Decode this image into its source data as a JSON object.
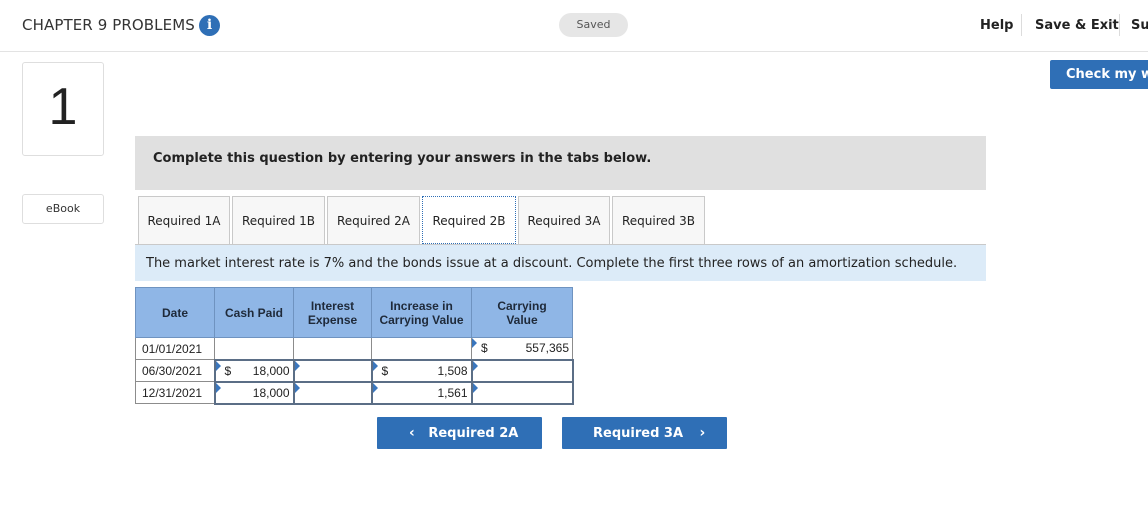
{
  "header": {
    "title": "CHAPTER 9 PROBLEMS",
    "info_icon": "info-icon",
    "saved": "Saved",
    "help": "Help",
    "save_exit": "Save & Exit",
    "submit_partial": "Su"
  },
  "sidebar": {
    "question_number": "1",
    "ebook": "eBook"
  },
  "check_button": "Check my wo",
  "instruction": "Complete this question by entering your answers in the tabs below.",
  "tabs": [
    {
      "label": "Required 1A",
      "active": false
    },
    {
      "label": "Required 1B",
      "active": false
    },
    {
      "label": "Required 2A",
      "active": false
    },
    {
      "label": "Required 2B",
      "active": true
    },
    {
      "label": "Required 3A",
      "active": false
    },
    {
      "label": "Required 3B",
      "active": false
    }
  ],
  "prompt": "The market interest rate is 7% and the bonds issue at a discount. Complete the first three rows of an amortization schedule.",
  "table": {
    "headers": {
      "date": "Date",
      "cash_paid": "Cash Paid",
      "interest_1": "Interest",
      "interest_2": "Expense",
      "increase_1": "Increase in",
      "increase_2": "Carrying Value",
      "carrying_1": "Carrying",
      "carrying_2": "Value"
    },
    "rows": [
      {
        "date": "01/01/2021",
        "cash_symbol": "",
        "cash": "",
        "interest": "",
        "increase_symbol": "",
        "increase": "",
        "carrying_symbol": "$",
        "carrying": "557,365"
      },
      {
        "date": "06/30/2021",
        "cash_symbol": "$",
        "cash": "18,000",
        "interest": "",
        "increase_symbol": "$",
        "increase": "1,508",
        "carrying_symbol": "",
        "carrying": ""
      },
      {
        "date": "12/31/2021",
        "cash_symbol": "",
        "cash": "18,000",
        "interest": "",
        "increase_symbol": "",
        "increase": "1,561",
        "carrying_symbol": "",
        "carrying": ""
      }
    ]
  },
  "nav": {
    "prev_label": "Required 2A",
    "next_label": "Required 3A",
    "prev_chevron": "‹",
    "next_chevron": "›"
  },
  "colors": {
    "accent": "#2f6fb6",
    "table_header": "#8fb6e6",
    "prompt_band": "#dcebf8"
  }
}
